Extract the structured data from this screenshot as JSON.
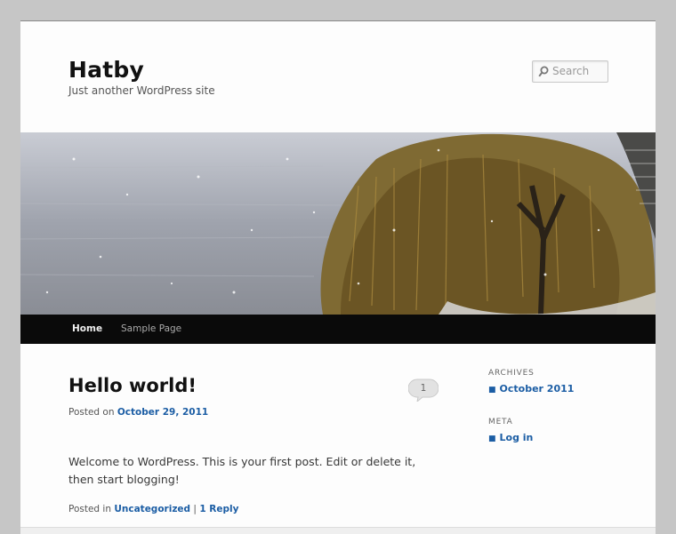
{
  "site": {
    "title": "Hatby",
    "description": "Just another WordPress site"
  },
  "search": {
    "placeholder": "Search"
  },
  "nav": {
    "home": "Home",
    "sample": "Sample Page"
  },
  "post": {
    "title": "Hello world!",
    "posted_on_prefix": "Posted on",
    "date": "October 29, 2011",
    "body": "Welcome to WordPress. This is your first post. Edit or delete it, then start blogging!",
    "posted_in_prefix": "Posted in",
    "category": "Uncategorized",
    "separator": "|",
    "reply": "1 Reply",
    "comment_count": "1"
  },
  "sidebar": {
    "archives_title": "ARCHIVES",
    "archives_item": "October 2011",
    "meta_title": "META",
    "meta_item": "Log in"
  },
  "colors": {
    "link": "#1b5da4",
    "nav_bg": "#0a0a0a",
    "page_bg": "#fdfdfd",
    "outer_bg": "#c6c6c6"
  }
}
